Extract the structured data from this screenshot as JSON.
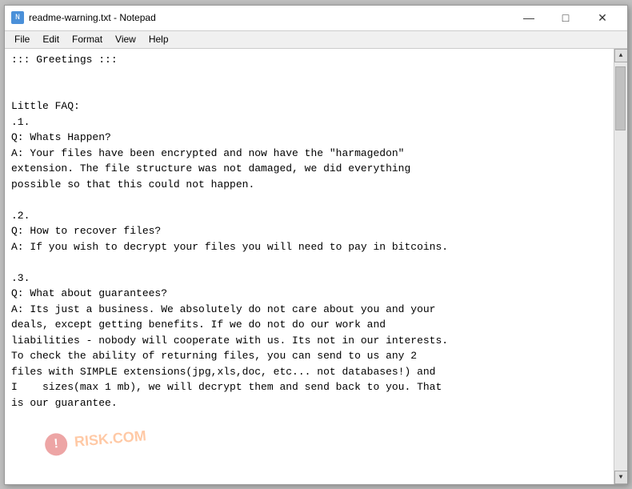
{
  "window": {
    "title": "readme-warning.txt - Notepad",
    "icon_label": "N"
  },
  "menu": {
    "items": [
      "File",
      "Edit",
      "Format",
      "View",
      "Help"
    ]
  },
  "controls": {
    "minimize": "—",
    "maximize": "□",
    "close": "✕"
  },
  "content": {
    "text": "::: Greetings :::\n\n\nLittle FAQ:\n.1.\nQ: Whats Happen?\nA: Your files have been encrypted and now have the \"harmagedon\"\nextension. The file structure was not damaged, we did everything\npossible so that this could not happen.\n\n.2.\nQ: How to recover files?\nA: If you wish to decrypt your files you will need to pay in bitcoins.\n\n.3.\nQ: What about guarantees?\nA: Its just a business. We absolutely do not care about you and your\ndeals, except getting benefits. If we do not do our work and\nliabilities - nobody will cooperate with us. Its not in our interests.\nTo check the ability of returning files, you can send to us any 2\nfiles with SIMPLE extensions(jpg,xls,doc, etc... not databases!) and\nI    sizes(max 1 mb), we will decrypt them and send back to you. That\nis our guarantee."
  },
  "watermark": {
    "text": "RISK.COM",
    "icon": "!"
  },
  "scrollbar": {
    "up_arrow": "▲",
    "down_arrow": "▼"
  }
}
